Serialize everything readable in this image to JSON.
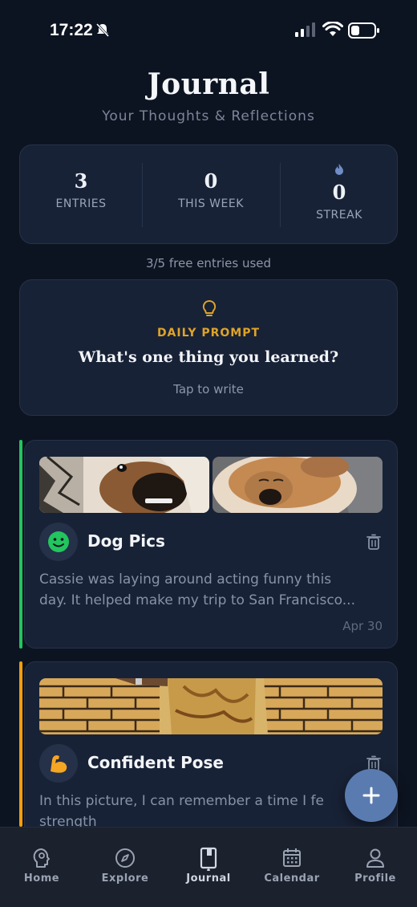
{
  "status_bar": {
    "time": "17:22"
  },
  "header": {
    "title": "Journal",
    "subtitle": "Your Thoughts & Reflections"
  },
  "stats": {
    "entries": {
      "value": "3",
      "label": "ENTRIES"
    },
    "this_week": {
      "value": "0",
      "label": "THIS WEEK"
    },
    "streak": {
      "value": "0",
      "label": "STREAK",
      "icon": "flame-icon"
    }
  },
  "usage": {
    "text": "3/5 free entries used"
  },
  "daily_prompt": {
    "icon": "lightbulb-icon",
    "label": "DAILY PROMPT",
    "question": "What's one thing you learned?",
    "cta": "Tap to write"
  },
  "entries": [
    {
      "title": "Dog Pics",
      "mood_icon": "smiley-face-icon",
      "accent_color": "#22c55e",
      "excerpt_line1": "Cassie was laying around acting funny this",
      "excerpt_line2": "day. It helped make my trip to San Francisco...",
      "date": "Apr 30",
      "photos": [
        "dog-closeup-photo",
        "dog-sleeping-photo"
      ]
    },
    {
      "title": "Confident Pose",
      "mood_icon": "flexed-biceps-icon",
      "accent_color": "#f59e0b",
      "excerpt_line1": "In this picture, I can remember a time I fe",
      "excerpt_line2": "strength",
      "photos": [
        "brick-wall-pose-photo"
      ]
    }
  ],
  "fab": {
    "icon": "plus-icon"
  },
  "tab_bar": {
    "active": "Journal",
    "tabs": [
      {
        "label": "Home",
        "icon": "lightbulb-head-icon"
      },
      {
        "label": "Explore",
        "icon": "compass-icon"
      },
      {
        "label": "Journal",
        "icon": "journal-book-icon"
      },
      {
        "label": "Calendar",
        "icon": "calendar-icon"
      },
      {
        "label": "Profile",
        "icon": "person-icon"
      }
    ]
  },
  "colors": {
    "background": "#0d1421",
    "card": "#182236",
    "accent_gold": "#e0a328",
    "fab": "#5a7bb0"
  }
}
